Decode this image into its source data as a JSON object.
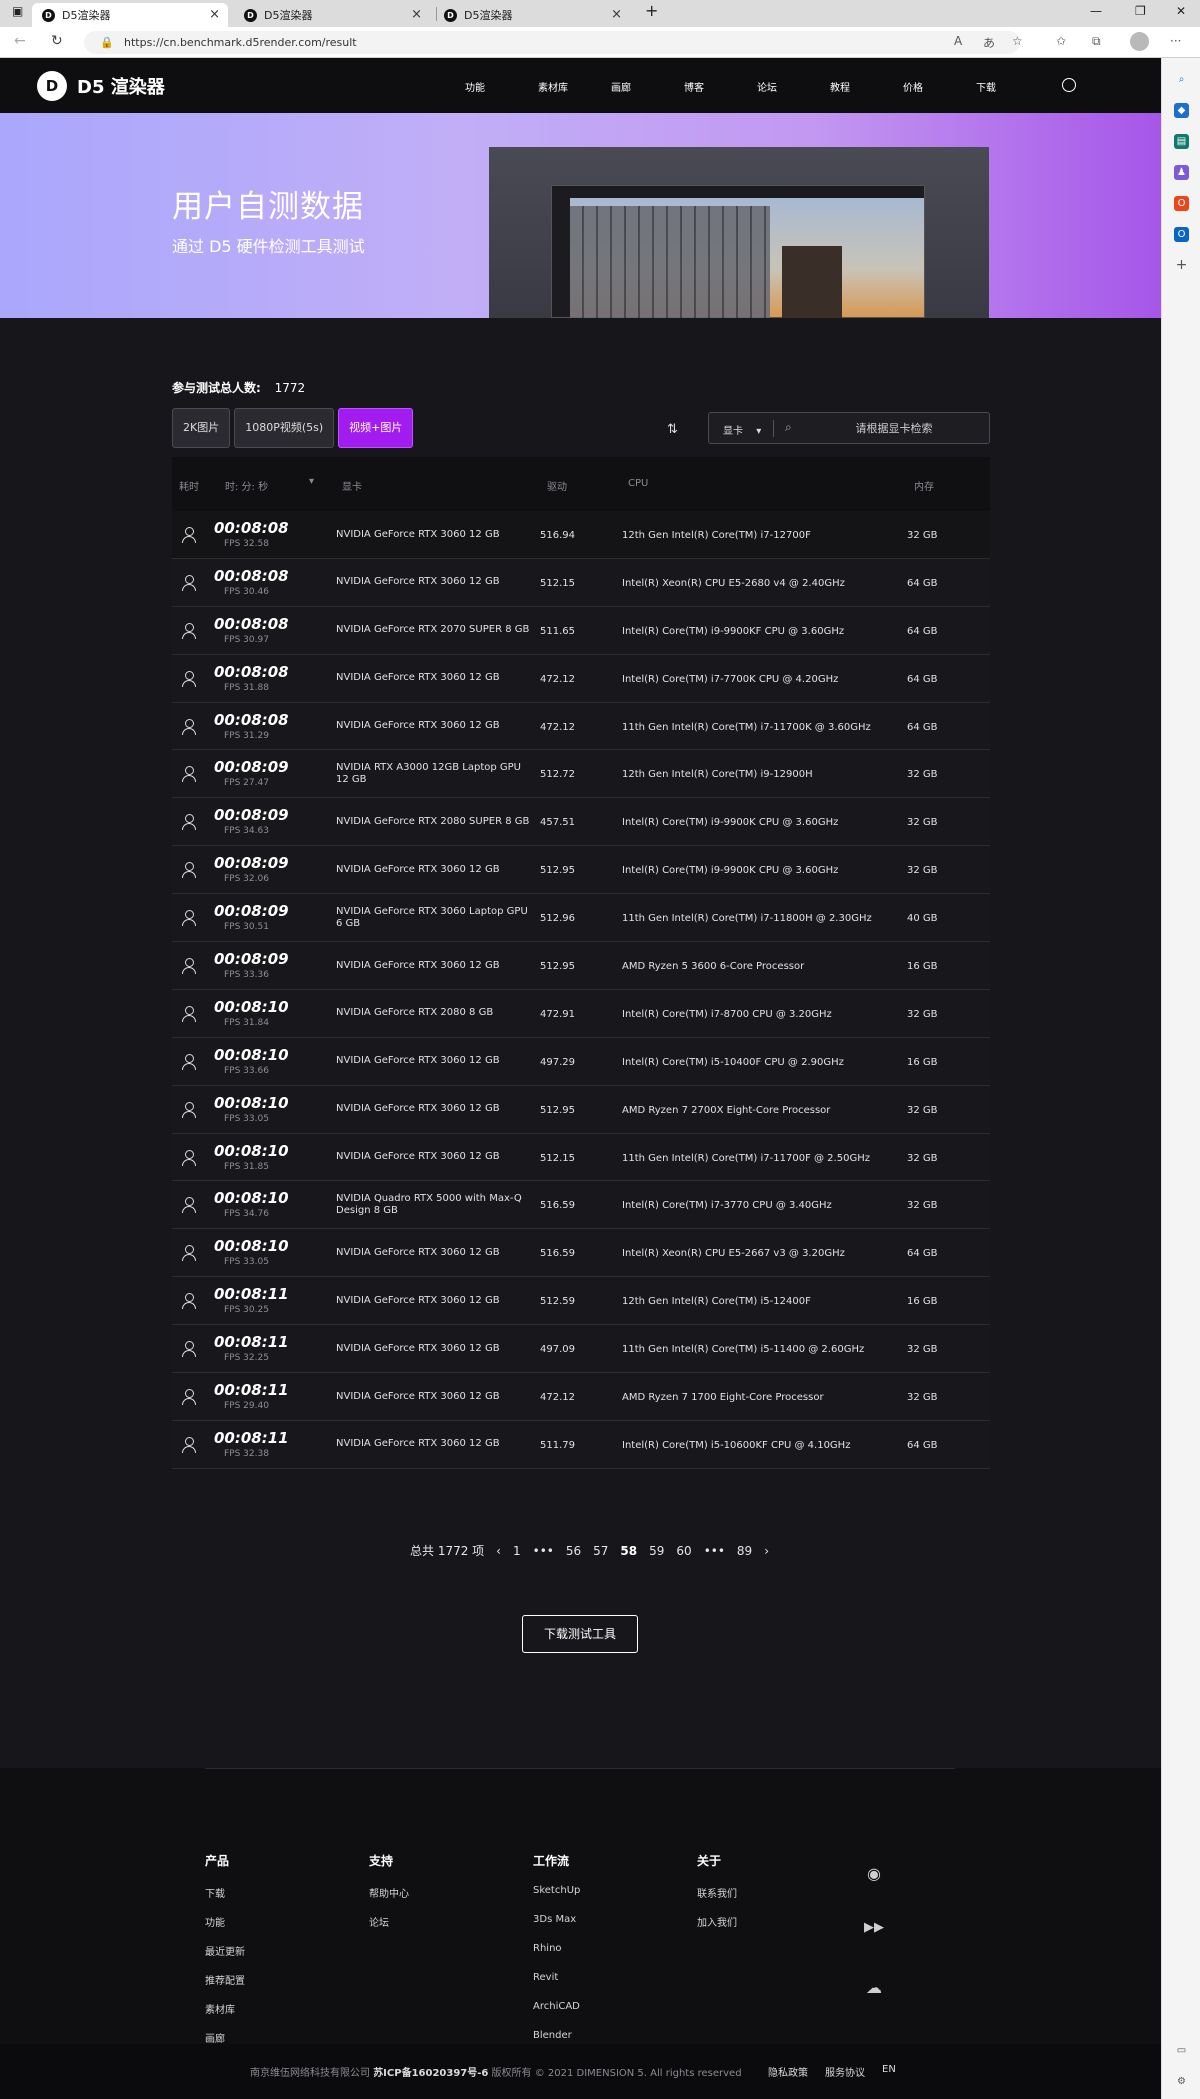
{
  "browser": {
    "tabs": [
      {
        "title": "D5渲染器",
        "active": true
      },
      {
        "title": "D5渲染器",
        "active": false
      },
      {
        "title": "D5渲染器",
        "active": false
      }
    ],
    "url": "https://cn.benchmark.d5render.com/result"
  },
  "header": {
    "logo_mark": "D",
    "logo_text": "D5 渲染器",
    "menu": [
      "功能",
      "素材库",
      "画廊",
      "博客",
      "论坛",
      "教程",
      "价格",
      "下载"
    ]
  },
  "banner": {
    "title": "用户自测数据",
    "subtitle": "通过 D5 硬件检测工具测试"
  },
  "stats": {
    "label": "参与测试总人数:",
    "count": "1772"
  },
  "filters": [
    "2K图片",
    "1080P视频(5s)",
    "视频+图片"
  ],
  "search": {
    "select_label": "显卡",
    "placeholder": "请根据显卡检索"
  },
  "table": {
    "headers": {
      "time": "耗时",
      "time_unit": "时: 分: 秒",
      "gpu": "显卡",
      "driver": "驱动",
      "cpu": "CPU",
      "ram": "内存"
    },
    "rows": [
      {
        "time": "00:08:08",
        "fps": "FPS 32.58",
        "gpu": "NVIDIA GeForce RTX 3060 12 GB",
        "driver": "516.94",
        "cpu": "12th Gen Intel(R) Core(TM) i7-12700F",
        "ram": "32 GB"
      },
      {
        "time": "00:08:08",
        "fps": "FPS 30.46",
        "gpu": "NVIDIA GeForce RTX 3060 12 GB",
        "driver": "512.15",
        "cpu": "Intel(R) Xeon(R) CPU E5-2680 v4 @ 2.40GHz",
        "ram": "64 GB"
      },
      {
        "time": "00:08:08",
        "fps": "FPS 30.97",
        "gpu": "NVIDIA GeForce RTX 2070 SUPER 8 GB",
        "driver": "511.65",
        "cpu": "Intel(R) Core(TM) i9-9900KF CPU @ 3.60GHz",
        "ram": "64 GB"
      },
      {
        "time": "00:08:08",
        "fps": "FPS 31.88",
        "gpu": "NVIDIA GeForce RTX 3060 12 GB",
        "driver": "472.12",
        "cpu": "Intel(R) Core(TM) i7-7700K CPU @ 4.20GHz",
        "ram": "64 GB"
      },
      {
        "time": "00:08:08",
        "fps": "FPS 31.29",
        "gpu": "NVIDIA GeForce RTX 3060 12 GB",
        "driver": "472.12",
        "cpu": "11th Gen Intel(R) Core(TM) i7-11700K @ 3.60GHz",
        "ram": "64 GB"
      },
      {
        "time": "00:08:09",
        "fps": "FPS 27.47",
        "gpu": "NVIDIA RTX A3000 12GB Laptop GPU 12 GB",
        "driver": "512.72",
        "cpu": "12th Gen Intel(R) Core(TM) i9-12900H",
        "ram": "32 GB"
      },
      {
        "time": "00:08:09",
        "fps": "FPS 34.63",
        "gpu": "NVIDIA GeForce RTX 2080 SUPER 8 GB",
        "driver": "457.51",
        "cpu": "Intel(R) Core(TM) i9-9900K CPU @ 3.60GHz",
        "ram": "32 GB"
      },
      {
        "time": "00:08:09",
        "fps": "FPS 32.06",
        "gpu": "NVIDIA GeForce RTX 3060 12 GB",
        "driver": "512.95",
        "cpu": "Intel(R) Core(TM) i9-9900K CPU @ 3.60GHz",
        "ram": "32 GB"
      },
      {
        "time": "00:08:09",
        "fps": "FPS 30.51",
        "gpu": "NVIDIA GeForce RTX 3060 Laptop GPU 6 GB",
        "driver": "512.96",
        "cpu": "11th Gen Intel(R) Core(TM) i7-11800H @ 2.30GHz",
        "ram": "40 GB"
      },
      {
        "time": "00:08:09",
        "fps": "FPS 33.36",
        "gpu": "NVIDIA GeForce RTX 3060 12 GB",
        "driver": "512.95",
        "cpu": "AMD Ryzen 5 3600 6-Core Processor",
        "ram": "16 GB"
      },
      {
        "time": "00:08:10",
        "fps": "FPS 31.84",
        "gpu": "NVIDIA GeForce RTX 2080 8 GB",
        "driver": "472.91",
        "cpu": "Intel(R) Core(TM) i7-8700 CPU @ 3.20GHz",
        "ram": "32 GB"
      },
      {
        "time": "00:08:10",
        "fps": "FPS 33.66",
        "gpu": "NVIDIA GeForce RTX 3060 12 GB",
        "driver": "497.29",
        "cpu": "Intel(R) Core(TM) i5-10400F CPU @ 2.90GHz",
        "ram": "16 GB"
      },
      {
        "time": "00:08:10",
        "fps": "FPS 33.05",
        "gpu": "NVIDIA GeForce RTX 3060 12 GB",
        "driver": "512.95",
        "cpu": "AMD Ryzen 7 2700X Eight-Core Processor",
        "ram": "32 GB"
      },
      {
        "time": "00:08:10",
        "fps": "FPS 31.85",
        "gpu": "NVIDIA GeForce RTX 3060 12 GB",
        "driver": "512.15",
        "cpu": "11th Gen Intel(R) Core(TM) i7-11700F @ 2.50GHz",
        "ram": "32 GB"
      },
      {
        "time": "00:08:10",
        "fps": "FPS 34.76",
        "gpu": "NVIDIA Quadro RTX 5000 with Max-Q Design 8 GB",
        "driver": "516.59",
        "cpu": "Intel(R) Core(TM) i7-3770 CPU @ 3.40GHz",
        "ram": "32 GB"
      },
      {
        "time": "00:08:10",
        "fps": "FPS 33.05",
        "gpu": "NVIDIA GeForce RTX 3060 12 GB",
        "driver": "516.59",
        "cpu": "Intel(R) Xeon(R) CPU E5-2667 v3 @ 3.20GHz",
        "ram": "64 GB"
      },
      {
        "time": "00:08:11",
        "fps": "FPS 30.25",
        "gpu": "NVIDIA GeForce RTX 3060 12 GB",
        "driver": "512.59",
        "cpu": "12th Gen Intel(R) Core(TM) i5-12400F",
        "ram": "16 GB"
      },
      {
        "time": "00:08:11",
        "fps": "FPS 32.25",
        "gpu": "NVIDIA GeForce RTX 3060 12 GB",
        "driver": "497.09",
        "cpu": "11th Gen Intel(R) Core(TM) i5-11400 @ 2.60GHz",
        "ram": "32 GB"
      },
      {
        "time": "00:08:11",
        "fps": "FPS 29.40",
        "gpu": "NVIDIA GeForce RTX 3060 12 GB",
        "driver": "472.12",
        "cpu": "AMD Ryzen 7 1700 Eight-Core Processor",
        "ram": "32 GB"
      },
      {
        "time": "00:08:11",
        "fps": "FPS 32.38",
        "gpu": "NVIDIA GeForce RTX 3060 12 GB",
        "driver": "511.79",
        "cpu": "Intel(R) Core(TM) i5-10600KF CPU @ 4.10GHz",
        "ram": "64 GB"
      }
    ]
  },
  "pagination": {
    "total": "总共 1772 项",
    "prev": "‹",
    "pages": [
      "1",
      "•••",
      "56",
      "57",
      "58",
      "59",
      "60",
      "•••",
      "89"
    ],
    "current": "58",
    "next": "›"
  },
  "download_button": "下载测试工具",
  "footer": {
    "columns": [
      {
        "title": "产品",
        "links": [
          "下载",
          "功能",
          "最近更新",
          "推荐配置",
          "素材库",
          "画廊"
        ]
      },
      {
        "title": "支持",
        "links": [
          "帮助中心",
          "论坛"
        ]
      },
      {
        "title": "工作流",
        "links": [
          "SketchUp",
          "3Ds Max",
          "Rhino",
          "Revit",
          "ArchiCAD",
          "Blender"
        ]
      },
      {
        "title": "关于",
        "links": [
          "联系我们",
          "加入我们"
        ]
      }
    ],
    "company": "南京维伍网络科技有限公司",
    "icp": "苏ICP备16020397号-6",
    "copyright": "版权所有 © 2021 DIMENSION 5. All rights reserved",
    "privacy": "隐私政策",
    "terms": "服务协议",
    "lang": "EN"
  },
  "colors": {
    "accent": "#a21cf0",
    "page_bg": "#17171b",
    "banner_start": "#aaa7fc",
    "banner_end": "#a656e8"
  }
}
